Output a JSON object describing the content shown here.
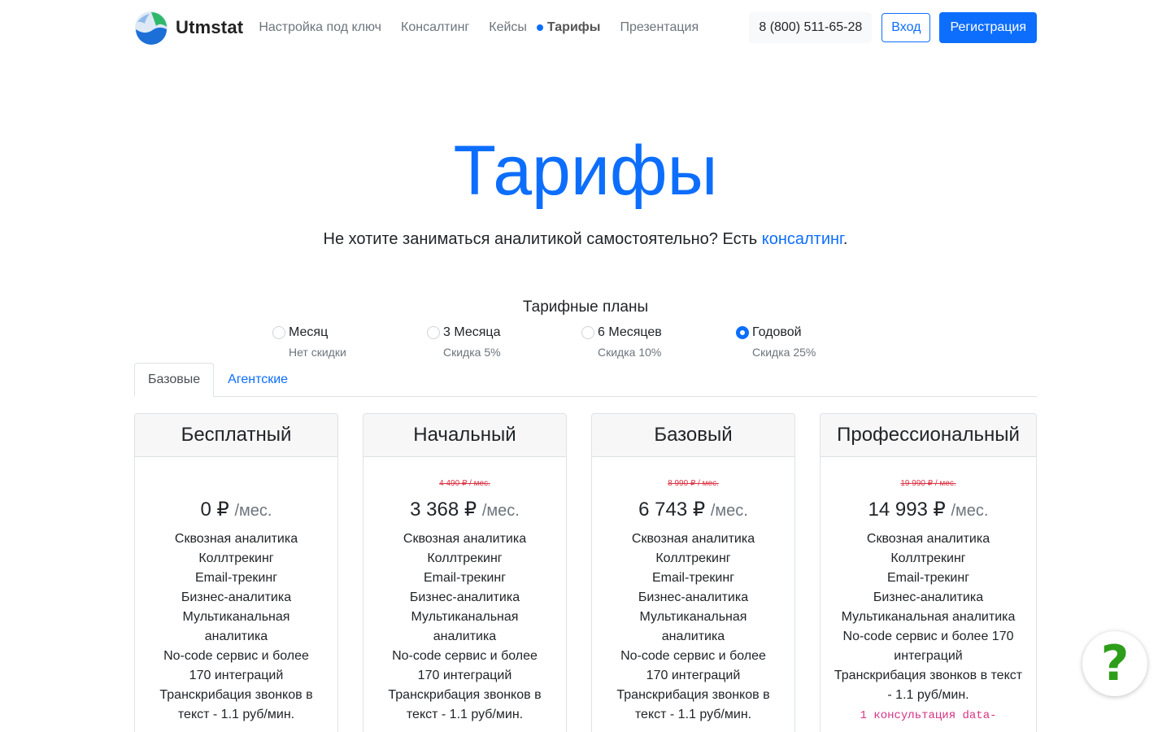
{
  "nav": {
    "brand": "Utmstat",
    "links": [
      {
        "label": "Настройка под ключ",
        "active": false
      },
      {
        "label": "Консалтинг",
        "active": false
      },
      {
        "label": "Кейсы",
        "active": false
      },
      {
        "label": "Тарифы",
        "active": true
      },
      {
        "label": "Презентация",
        "active": false
      }
    ],
    "phone": "8 (800) 511-65-28",
    "login_label": "Вход",
    "signup_label": "Регистрация"
  },
  "hero": {
    "title": "Тарифы",
    "subtitle_text": "Не хотите заниматься аналитикой самостоятельно? Есть ",
    "subtitle_link": "консалтинг",
    "subtitle_end": "."
  },
  "plans": {
    "heading": "Тарифные планы",
    "periods": [
      {
        "label": "Месяц",
        "note": "Нет скидки",
        "checked": false
      },
      {
        "label": "3 Месяца",
        "note": "Скидка 5%",
        "checked": false
      },
      {
        "label": "6 Месяцев",
        "note": "Скидка 10%",
        "checked": false
      },
      {
        "label": "Годовой",
        "note": "Скидка 25%",
        "checked": true
      }
    ]
  },
  "tabs": [
    {
      "label": "Базовые",
      "active": true
    },
    {
      "label": "Агентские",
      "active": false
    }
  ],
  "cards": [
    {
      "name": "Бесплатный",
      "old_price": "",
      "price": "0 ₽",
      "unit": "/мес.",
      "features": [
        "Сквозная аналитика",
        "Коллтрекинг",
        "Email-трекинг",
        "Бизнес-аналитика",
        "Мультиканальная аналитика",
        "No-code сервис и более 170 интеграций",
        "Транскрибация звонков в текст - 1.1 руб/мин."
      ],
      "consult": ""
    },
    {
      "name": "Начальный",
      "old_price": "4 490 ₽ / мес.",
      "price": "3 368 ₽",
      "unit": "/мес.",
      "features": [
        "Сквозная аналитика",
        "Коллтрекинг",
        "Email-трекинг",
        "Бизнес-аналитика",
        "Мультиканальная аналитика",
        "No-code сервис и более 170 интеграций",
        "Транскрибация звонков в текст - 1.1 руб/мин."
      ],
      "consult": ""
    },
    {
      "name": "Базовый",
      "old_price": "8 990 ₽ / мес.",
      "price": "6 743 ₽",
      "unit": "/мес.",
      "features": [
        "Сквозная аналитика",
        "Коллтрекинг",
        "Email-трекинг",
        "Бизнес-аналитика",
        "Мультиканальная аналитика",
        "No-code сервис и более 170 интеграций",
        "Транскрибация звонков в текст - 1.1 руб/мин."
      ],
      "consult": ""
    },
    {
      "name": "Профессиональный",
      "old_price": "19 990 ₽ / мес.",
      "price": "14 993 ₽",
      "unit": "/мес.",
      "features": [
        "Сквозная аналитика",
        "Коллтрекинг",
        "Email-трекинг",
        "Бизнес-аналитика",
        "Мультиканальная аналитика",
        "No-code сервис и более 170 интеграций",
        "Транскрибация звонков в текст - 1.1 руб/мин."
      ],
      "consult": "1 консультация data-"
    }
  ],
  "help": {
    "label": "?",
    "icon": "question-icon"
  },
  "colors": {
    "accent": "#0d6efd",
    "muted": "#6c757d",
    "strike": "#dc3545",
    "code": "#d63384",
    "help": "#2e9e1a"
  }
}
